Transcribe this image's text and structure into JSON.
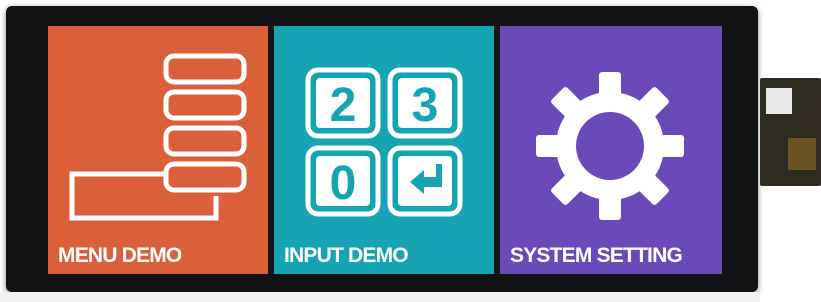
{
  "tiles": [
    {
      "label": "MENU DEMO",
      "color": "#d9603a",
      "icon": "menu-list-icon"
    },
    {
      "label": "INPUT DEMO",
      "color": "#16a4b4",
      "icon": "keypad-icon"
    },
    {
      "label": "SYSTEM SETTING",
      "color": "#6a4ab8",
      "icon": "gear-icon"
    }
  ],
  "keypad": {
    "keys": [
      "2",
      "3",
      "0",
      "↵"
    ]
  },
  "colors": {
    "bezel": "#111214",
    "icon_stroke": "#ffffff"
  }
}
